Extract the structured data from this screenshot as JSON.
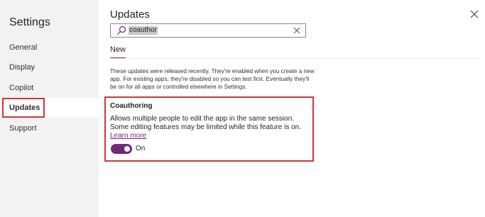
{
  "sidebar": {
    "title": "Settings",
    "items": [
      {
        "label": "General"
      },
      {
        "label": "Display"
      },
      {
        "label": "Copilot"
      },
      {
        "label": "Updates",
        "selected": true
      },
      {
        "label": "Support"
      }
    ]
  },
  "panel": {
    "title": "Updates",
    "search": {
      "value": "coauthor"
    },
    "tab": {
      "label": "New"
    },
    "intro": "These updates were released recently. They're enabled when you create a new app. For existing apps, they're disabled so you can test first. Eventually they'll be on for all apps or controlled elsewhere in Settings."
  },
  "feature": {
    "title": "Coauthoring",
    "description": "Allows multiple people to edit the app in the same session. Some editing features may be limited while this feature is on.",
    "link": "Learn more",
    "toggle_state": "On",
    "toggle_on": true
  },
  "colors": {
    "accent": "#742774",
    "highlight": "#d13438",
    "sidebar_bg": "#f3f2f1"
  }
}
